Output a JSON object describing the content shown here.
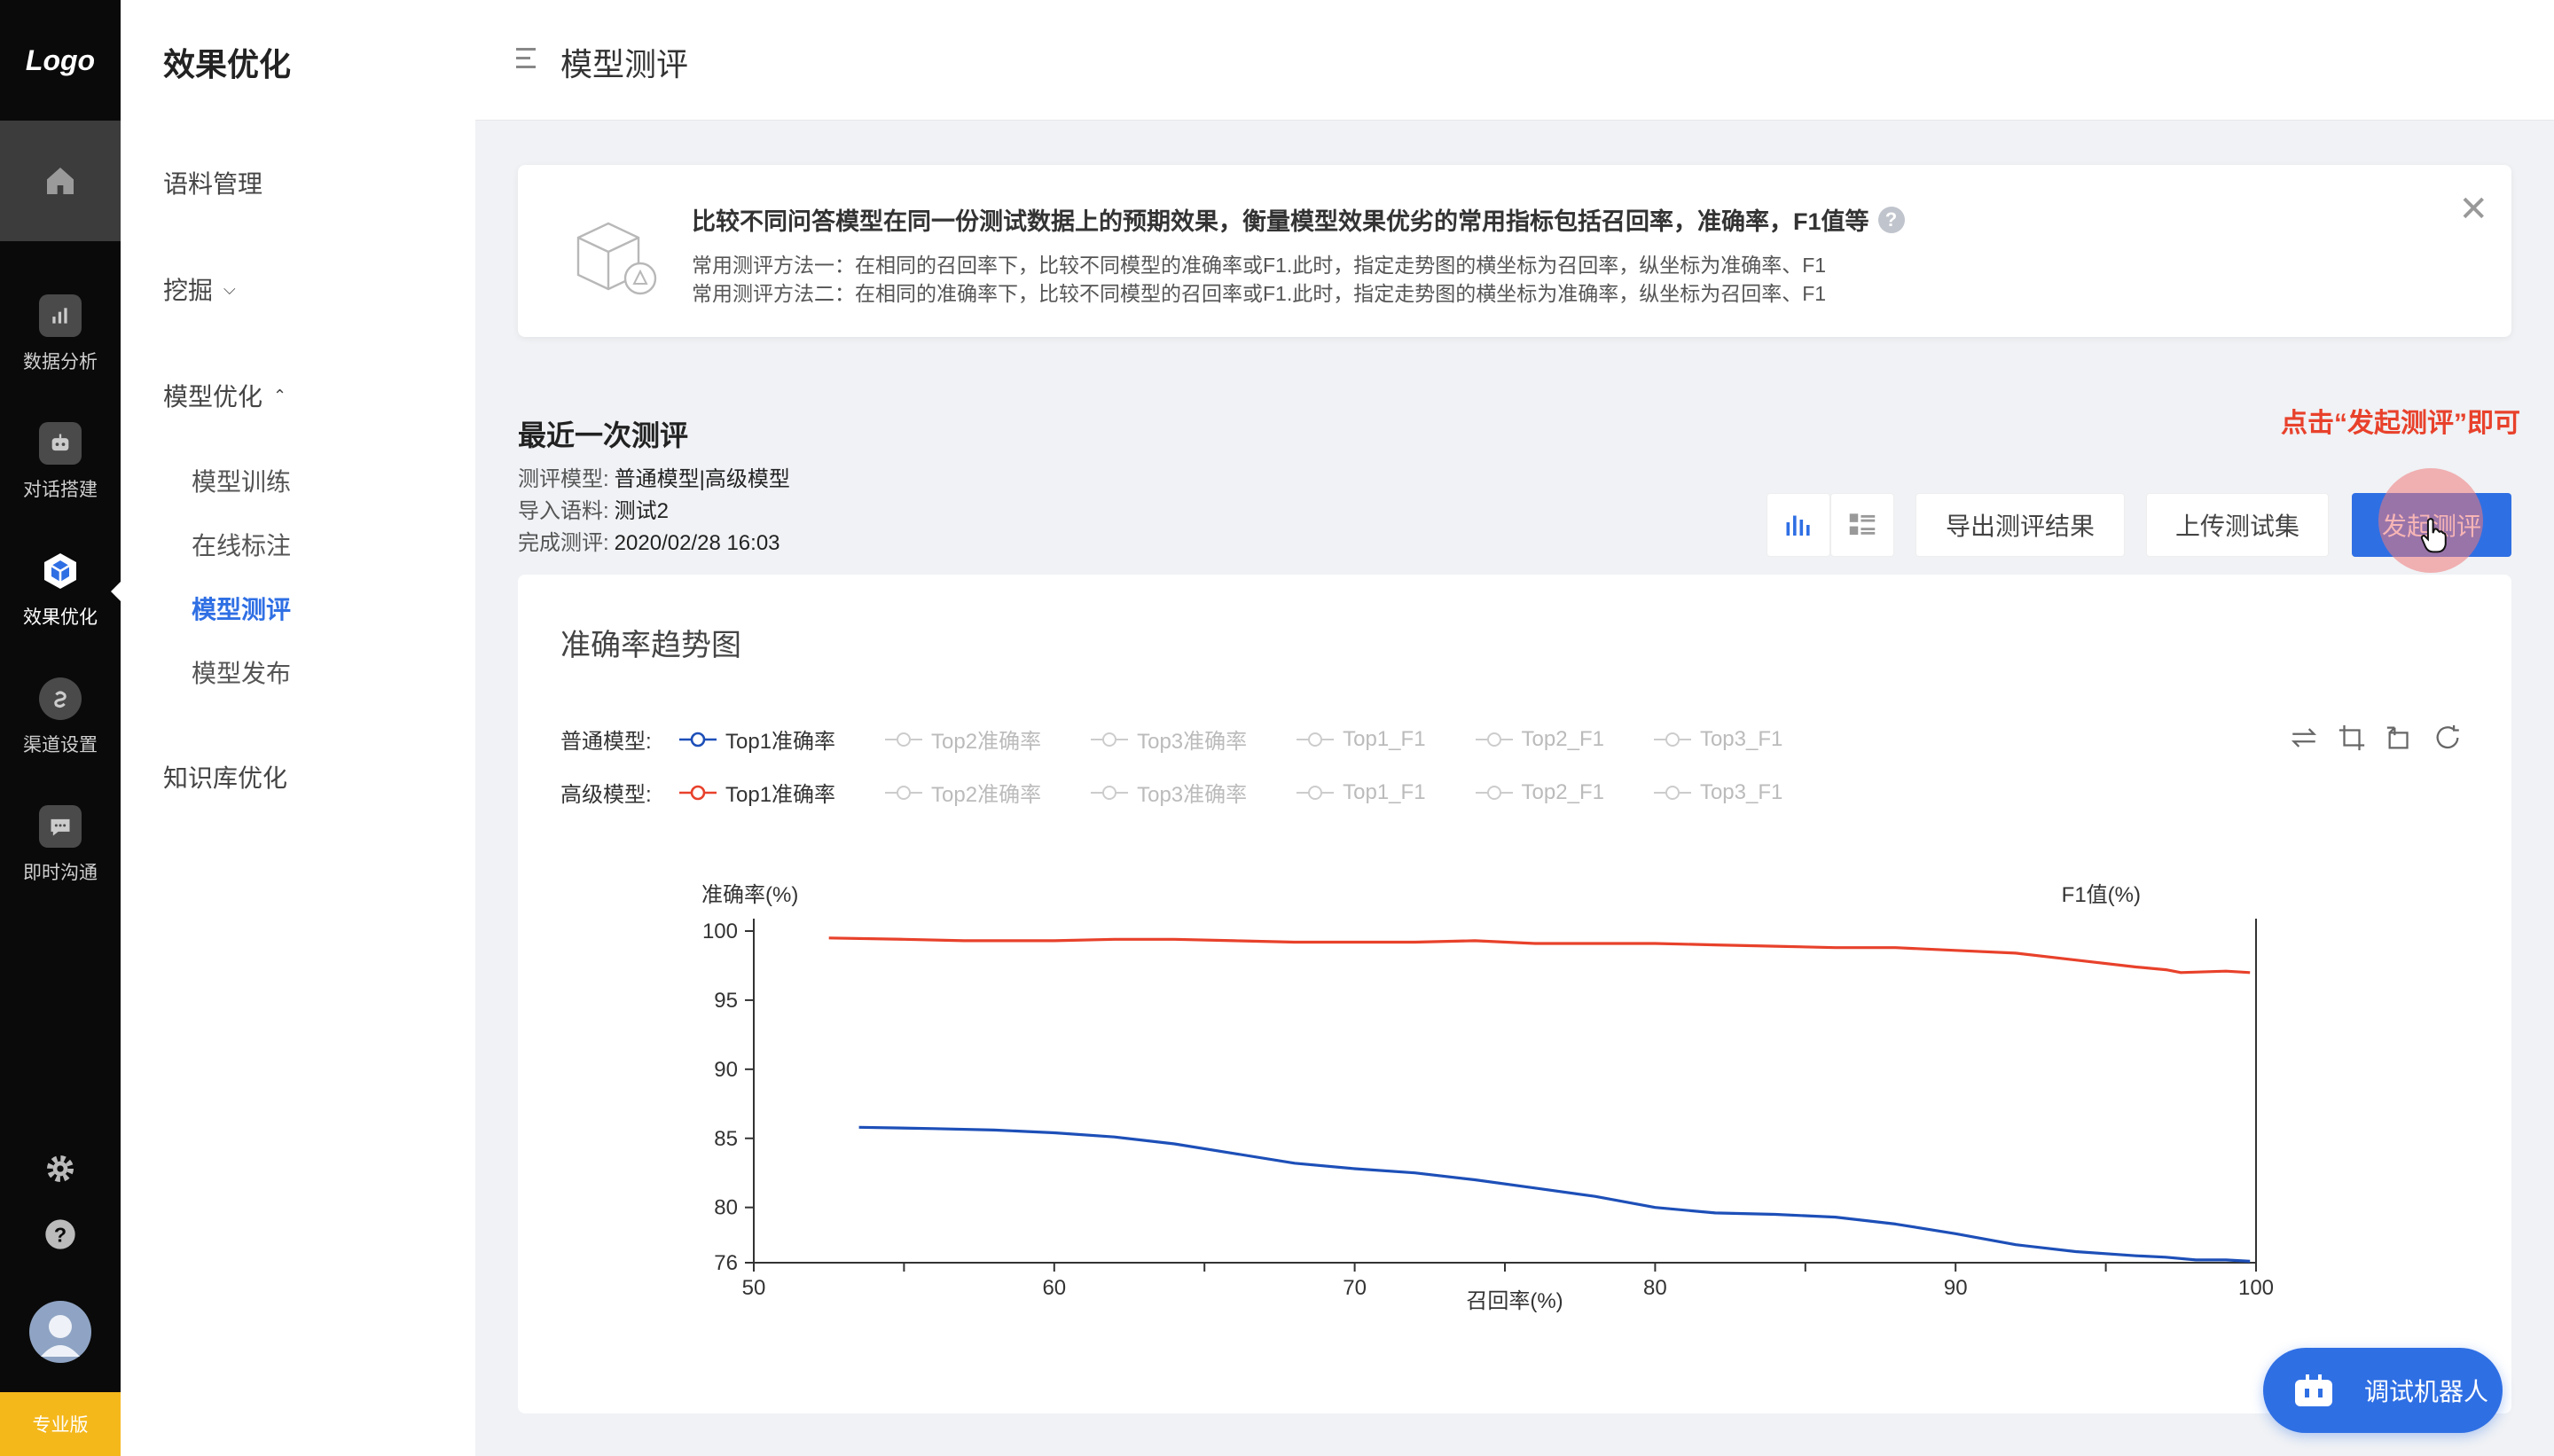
{
  "rail": {
    "logo": "Logo",
    "items": [
      {
        "label": "数据分析",
        "icon": "bar-chart-icon"
      },
      {
        "label": "对话搭建",
        "icon": "robot-icon"
      },
      {
        "label": "效果优化",
        "icon": "cube-icon",
        "active": true
      },
      {
        "label": "渠道设置",
        "icon": "channel-icon"
      },
      {
        "label": "即时沟通",
        "icon": "chat-bubble-icon"
      }
    ],
    "edition": "专业版"
  },
  "nav": {
    "title": "效果优化",
    "items": [
      {
        "label": "语料管理"
      },
      {
        "label": "挖掘",
        "chevron": "down"
      },
      {
        "label": "模型优化",
        "chevron": "up",
        "children": [
          "模型训练",
          "在线标注",
          "模型测评",
          "模型发布"
        ],
        "active_child": "模型测评"
      },
      {
        "label": "知识库优化"
      }
    ]
  },
  "header": {
    "title": "模型测评"
  },
  "info": {
    "headline": "比较不同问答模型在同一份测试数据上的预期效果，衡量模型效果优劣的常用指标包括召回率，准确率，F1值等",
    "method1": "常用测评方法一：在相同的召回率下，比较不同模型的准确率或F1.此时，指定走势图的横坐标为召回率，纵坐标为准确率、F1",
    "method2": "常用测评方法二：在相同的准确率下，比较不同模型的召回率或F1.此时，指定走势图的横坐标为准确率，纵坐标为召回率、F1"
  },
  "recent": {
    "title": "最近一次测评",
    "model_label": "测评模型:",
    "model_value": "普通模型|高级模型",
    "data_label": "导入语料:",
    "data_value": "测试2",
    "done_label": "完成测评:",
    "done_value": "2020/02/28 16:03",
    "hint": "点击“发起测评”即可"
  },
  "toolbar": {
    "export": "导出测评结果",
    "upload": "上传测试集",
    "start": "发起测评"
  },
  "legend": {
    "normal_label": "普通模型:",
    "advanced_label": "高级模型:",
    "items": [
      "Top1准确率",
      "Top2准确率",
      "Top3准确率",
      "Top1_F1",
      "Top2_F1",
      "Top3_F1"
    ]
  },
  "colors": {
    "accent": "#2f6fe4",
    "normal_series": "#1d4fb8",
    "advanced_series": "#e8412b",
    "hint": "#e8412b",
    "edition": "#f5b81b"
  },
  "chart_data": {
    "type": "line",
    "title": "准确率趋势图",
    "xlabel": "召回率(%)",
    "ylabel": "准确率(%)",
    "y2label": "F1值(%)",
    "xlim": [
      50,
      100
    ],
    "ylim": [
      76,
      100
    ],
    "x_ticks": [
      50,
      60,
      70,
      80,
      90,
      100
    ],
    "y_ticks": [
      76,
      80,
      85,
      90,
      95,
      100
    ],
    "series": [
      {
        "name": "高级模型 Top1准确率",
        "color": "#e8412b",
        "x": [
          52.5,
          55,
          57,
          60,
          62,
          64,
          66,
          68,
          70,
          72,
          74,
          76,
          78,
          80,
          82,
          84,
          86,
          88,
          90,
          92,
          94,
          96,
          97,
          97.5,
          99,
          99.8
        ],
        "y": [
          99.5,
          99.4,
          99.3,
          99.3,
          99.4,
          99.4,
          99.3,
          99.2,
          99.2,
          99.2,
          99.3,
          99.1,
          99.1,
          99.1,
          99.0,
          98.9,
          98.8,
          98.8,
          98.6,
          98.4,
          97.9,
          97.4,
          97.2,
          97.0,
          97.1,
          97.0
        ]
      },
      {
        "name": "普通模型 Top1准确率",
        "color": "#1d4fb8",
        "x": [
          53.5,
          56,
          58,
          60,
          62,
          64,
          66,
          68,
          70,
          72,
          74,
          76,
          78,
          80,
          82,
          84,
          86,
          88,
          90,
          92,
          94,
          96,
          97,
          98,
          99,
          99.8
        ],
        "y": [
          85.8,
          85.7,
          85.6,
          85.4,
          85.1,
          84.6,
          83.9,
          83.2,
          82.8,
          82.5,
          82.0,
          81.4,
          80.8,
          80.0,
          79.6,
          79.5,
          79.3,
          78.8,
          78.1,
          77.3,
          76.8,
          76.5,
          76.4,
          76.2,
          76.2,
          76.1
        ]
      }
    ]
  }
}
